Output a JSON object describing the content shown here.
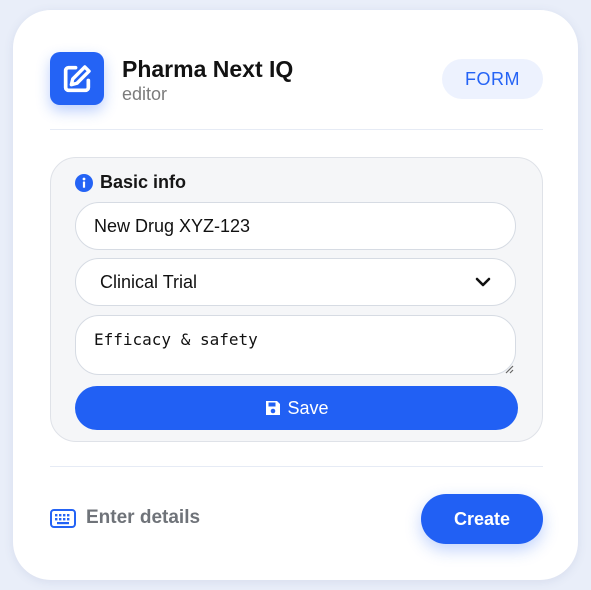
{
  "header": {
    "title": "Pharma Next IQ",
    "subtitle": "editor",
    "badge": "FORM",
    "app_icon": "edit-square-icon"
  },
  "basic_info": {
    "title": "Basic info",
    "icon": "info-circle-icon",
    "name_value": "New Drug XYZ-123",
    "type_selected": "Clinical Trial",
    "notes_value": "Efficacy & safety",
    "save_label": "Save",
    "save_icon": "floppy-disk-icon"
  },
  "footer": {
    "hint": "Enter details",
    "hint_icon": "keyboard-icon",
    "create_label": "Create"
  },
  "colors": {
    "accent": "#2463f5",
    "background": "#e9eef9",
    "badge_bg": "#edf2fe"
  }
}
